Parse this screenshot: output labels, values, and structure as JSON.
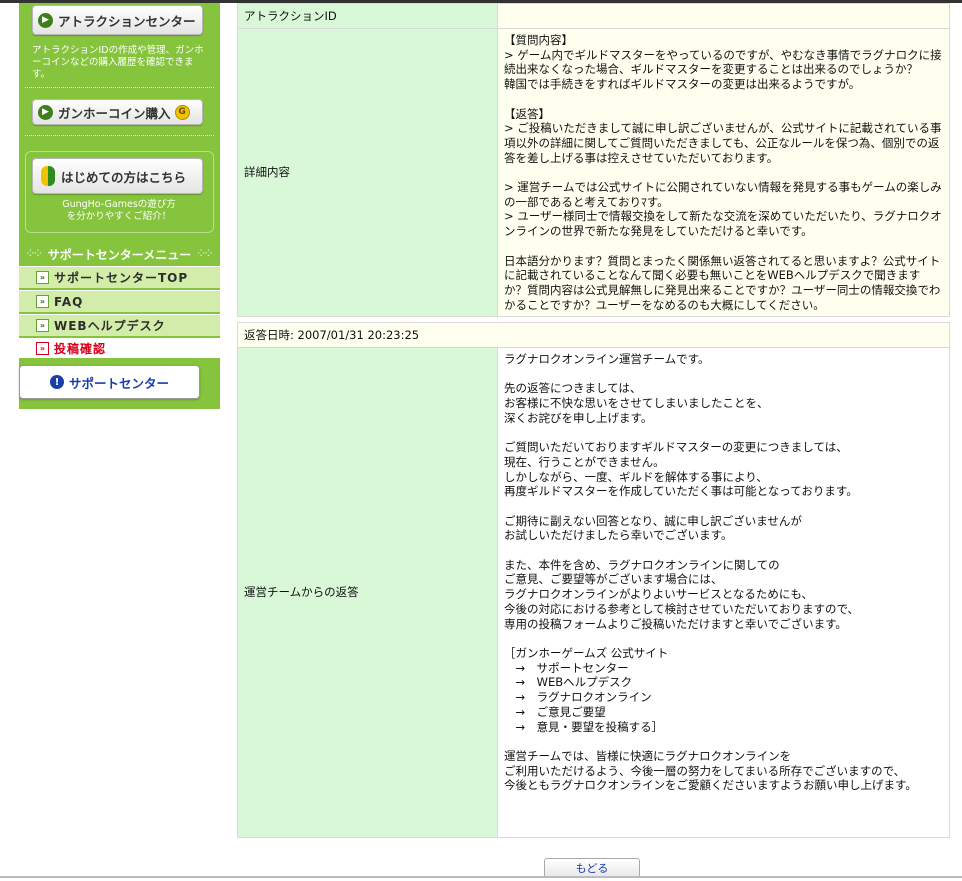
{
  "sidebar": {
    "attraction_button": "アトラクションセンター",
    "attraction_desc": "アトラクションIDの作成や管理、ガンホーコインなどの購入履歴を確認できます。",
    "coin_button": "ガンホーコイン購入",
    "coin_icon_text": "G",
    "beginner_button": "はじめての方はこちら",
    "beginner_desc": "GungHo-Gamesの遊び方を分かりやすくご紹介！",
    "menu_heading": "サポートセンターメニュー",
    "menu_items": [
      {
        "label": "サポートセンターTOP"
      },
      {
        "label": "FAQ"
      },
      {
        "label": "WEBヘルプデスク"
      },
      {
        "label": "投稿確認"
      }
    ],
    "support_button": "サポートセンター"
  },
  "inquiry": {
    "id_label": "アトラクションID",
    "id_value": "",
    "detail_label": "詳細内容",
    "detail_paragraphs": [
      "【質問内容】\n> ゲーム内でギルドマスターをやっているのですが、やむなき事情でラグナロクに接続出来なくなった場合、ギルドマスターを変更することは出来るのでしょうか？\n韓国では手続きをすればギルドマスターの変更は出来るようですが。",
      "【返答】\n> ご投稿いただきまして誠に申し訳ございませんが、公式サイトに記載されている事項以外の詳細に関してご質問いただきましても、公正なルールを保つ為、個別での返答を差し上げる事は控えさせていただいております。",
      "> 運営チームでは公式サイトに公開されていない情報を発見する事もゲームの楽しみの一部であると考えておりﾏす。\n> ユーザー様同士で情報交換をして新たな交流を深めていただいたり、ラグナロクオンラインの世界で新たな発見をしていただけると幸いです。",
      "日本語分かります？質問とまったく関係無い返答されてると思いますよ？公式サイトに記載されていることなんて聞く必要も無いことをWEBヘルプデスクで聞きますか？質問内容は公式見解無しに発見出来ることですか？ユーザー同士の情報交換でわかることですか？ユーザーをなめるのも大概にしてください。"
    ]
  },
  "reply": {
    "datetime": "返答日時: 2007/01/31 20:23:25",
    "label": "運営チームからの返答",
    "paragraphs": [
      "ラグナロクオンライン運営チームです。",
      "先の返答につきましては、\nお客様に不快な思いをさせてしまいましたことを、\n深くお詫びを申し上げます。",
      "ご質問いただいておりますギルドマスターの変更につきましては、\n現在、行うことができません。\nしかしながら、一度、ギルドを解体する事により、\n再度ギルドマスターを作成していただく事は可能となっております。",
      "ご期待に副えない回答となり、誠に申し訳ございませんが\nお試しいただけましたら幸いでございます。",
      "また、本件を含め、ラグナロクオンラインに関しての\nご意見、ご要望等がございます場合には、\nラグナロクオンラインがよりよいサービスとなるためにも、\n今後の対応における参考として検討させていただいておりますので、\n専用の投稿フォームよりご投稿いただけますと幸いでございます。",
      "［ガンホーゲームズ 公式サイト\n　→　サポートセンター\n　→　WEBヘルプデスク\n　→　ラグナロクオンライン\n　→　ご意見ご要望\n　→　意見・要望を投稿する］",
      "運営チームでは、皆様に快適にラグナロクオンラインを\nご利用いただけるよう、今後一層の努力をしてまいる所存でございますので、\n今後ともラグナロクオンラインをご愛顧くださいますようお願い申し上げます。"
    ]
  },
  "back_button": "もどる"
}
